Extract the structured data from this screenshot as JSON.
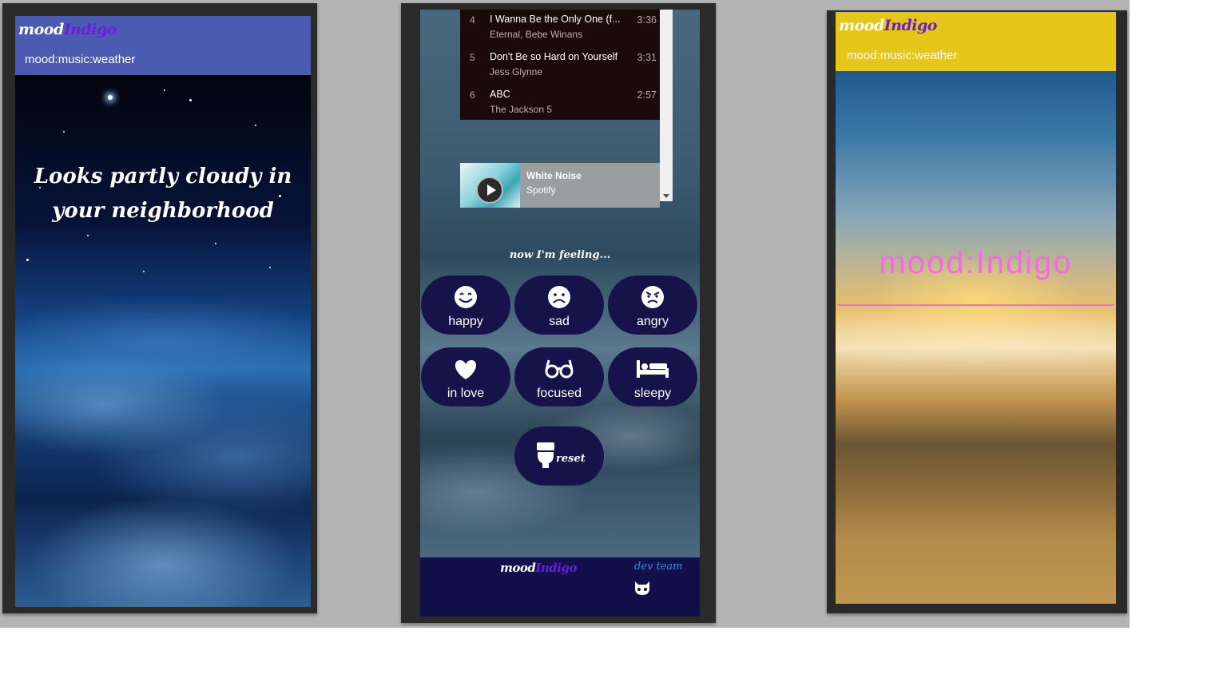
{
  "brand": {
    "mood": "mood",
    "indigo": "Indigo",
    "tagline": "mood:music:weather"
  },
  "phone1": {
    "weather_message": "Looks partly cloudy in your neighborhood"
  },
  "phone2": {
    "playlist": [
      {
        "num": "4",
        "title": "I Wanna Be the Only One (f...",
        "artist": "Eternal, Bebe Winans",
        "duration": "3:36"
      },
      {
        "num": "5",
        "title": "Don't Be so Hard on Yourself",
        "artist": "Jess Glynne",
        "duration": "3:31"
      },
      {
        "num": "6",
        "title": "ABC",
        "artist": "The Jackson 5",
        "duration": "2:57"
      }
    ],
    "player": {
      "title": "White Noise",
      "source": "Spotify"
    },
    "prompt": "now I'm feeling...",
    "moods": [
      {
        "label": "happy",
        "icon": "smile-icon"
      },
      {
        "label": "sad",
        "icon": "frown-icon"
      },
      {
        "label": "angry",
        "icon": "angry-icon"
      },
      {
        "label": "in love",
        "icon": "heart-icon"
      },
      {
        "label": "focused",
        "icon": "glasses-icon"
      },
      {
        "label": "sleepy",
        "icon": "bed-icon"
      }
    ],
    "reset": {
      "label": "reset",
      "icon": "toilet-icon"
    },
    "footer": {
      "dev_team": "dev team"
    }
  },
  "phone3": {
    "title": "mood:Indigo"
  },
  "colors": {
    "header_blue": "#4b5bb2",
    "header_yellow": "#e6c619",
    "indigo": "#6a1ed6",
    "mood_button": "#16134a",
    "title_pink": "#f06ce0"
  }
}
